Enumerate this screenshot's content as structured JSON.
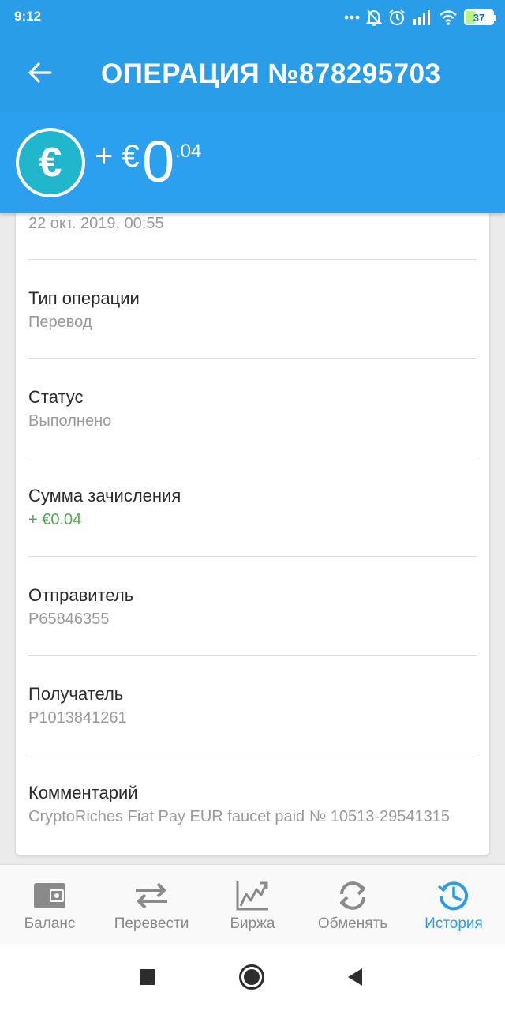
{
  "status_bar": {
    "time": "9:12",
    "battery": "37",
    "icons": [
      "more-dots-icon",
      "bell-off-icon",
      "alarm-icon",
      "signal-icon",
      "wifi-icon",
      "battery-icon"
    ]
  },
  "app_bar": {
    "title": "ОПЕРАЦИЯ №878295703",
    "back_icon": "arrow-left-icon"
  },
  "amount_banner": {
    "currency_icon": "euro-icon",
    "currency_symbol": "€",
    "sign": "+ €",
    "integer": "0",
    "fraction": ".04"
  },
  "details": {
    "date": "22 окт. 2019, 00:55",
    "rows": [
      {
        "label": "Тип операции",
        "value": "Перевод"
      },
      {
        "label": "Статус",
        "value": "Выполнено"
      },
      {
        "label": "Сумма зачисления",
        "value": "+ €0.04"
      },
      {
        "label": "Отправитель",
        "value": "P65846355"
      },
      {
        "label": "Получатель",
        "value": "P1013841261"
      },
      {
        "label": "Комментарий",
        "value": "CryptoRiches Fiat Pay EUR faucet paid № 10513-29541315"
      }
    ]
  },
  "bottom_nav": {
    "items": [
      {
        "label": "Баланс",
        "icon": "wallet-icon",
        "active": false
      },
      {
        "label": "Перевести",
        "icon": "transfer-arrows-icon",
        "active": false
      },
      {
        "label": "Биржа",
        "icon": "chart-icon",
        "active": false
      },
      {
        "label": "Обменять",
        "icon": "refresh-icon",
        "active": false
      },
      {
        "label": "История",
        "icon": "history-icon",
        "active": true
      }
    ]
  },
  "colors": {
    "primary": "#2a9de9",
    "accent_teal": "#20b6cb",
    "positive": "#4caf50",
    "muted_text": "#9a9a9a"
  }
}
